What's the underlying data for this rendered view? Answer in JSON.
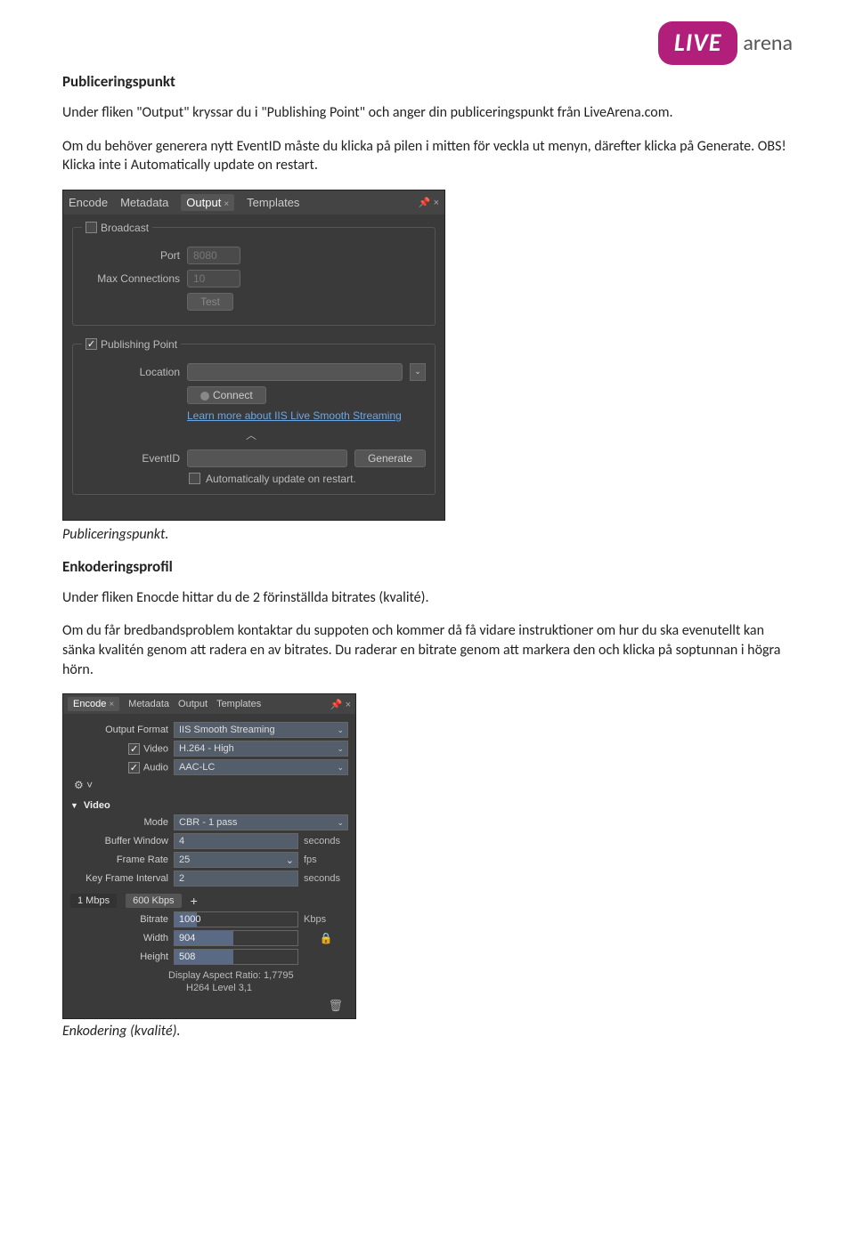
{
  "logo": {
    "brand": "LIVE",
    "suffix": "arena"
  },
  "sec1": {
    "heading": "Publiceringspunkt",
    "p1": "Under fliken \"Output\" kryssar du i \"Publishing Point\" och anger din publiceringspunkt från LiveArena.com.",
    "p2": "Om du behöver generera nytt EventID måste du klicka på pilen i mitten för veckla ut menyn, därefter klicka på Generate. OBS! Klicka inte i Automatically update on restart.",
    "caption": "Publiceringspunkt."
  },
  "panel1": {
    "tabs": [
      "Encode",
      "Metadata",
      "Output",
      "Templates"
    ],
    "active_tab": 2,
    "broadcast": {
      "legend": "Broadcast",
      "port_label": "Port",
      "port_value": "8080",
      "max_label": "Max Connections",
      "max_value": "10",
      "test": "Test"
    },
    "pub": {
      "legend": "Publishing Point",
      "loc_label": "Location",
      "connect": "Connect",
      "learn": "Learn more about IIS Live Smooth Streaming",
      "event_label": "EventID",
      "generate": "Generate",
      "auto": "Automatically update on restart."
    }
  },
  "sec2": {
    "heading": "Enkoderingsprofil",
    "p1": "Under fliken Enocde hittar du de 2 förinställda bitrates (kvalité).",
    "p2": "Om du får bredbandsproblem kontaktar du suppoten och kommer då få vidare instruktioner om hur du ska evenutellt kan sänka kvalitén genom att radera en av bitrates. Du raderar en bitrate genom att markera den och klicka på soptunnan i högra hörn.",
    "caption": "Enkodering (kvalité)."
  },
  "panel2": {
    "tabs": [
      "Encode",
      "Metadata",
      "Output",
      "Templates"
    ],
    "active_tab": 0,
    "outfmt_label": "Output Format",
    "outfmt_value": "IIS Smooth Streaming",
    "video_label": "Video",
    "video_value": "H.264 - High",
    "audio_label": "Audio",
    "audio_value": "AAC-LC",
    "videoHeader": "Video",
    "mode_label": "Mode",
    "mode_value": "CBR - 1 pass",
    "buf_label": "Buffer Window",
    "buf_value": "4",
    "buf_unit": "seconds",
    "fr_label": "Frame Rate",
    "fr_value": "25",
    "fr_unit": "fps",
    "kfi_label": "Key Frame Interval",
    "kfi_value": "2",
    "kfi_unit": "seconds",
    "bitrate_tabs": [
      "1 Mbps",
      "600 Kbps"
    ],
    "bitrate_label": "Bitrate",
    "bitrate_value": "1000",
    "bitrate_unit": "Kbps",
    "width_label": "Width",
    "width_value": "904",
    "height_label": "Height",
    "height_value": "508",
    "ratio": "Display Aspect Ratio: 1,7795",
    "h264": "H264 Level 3,1"
  }
}
